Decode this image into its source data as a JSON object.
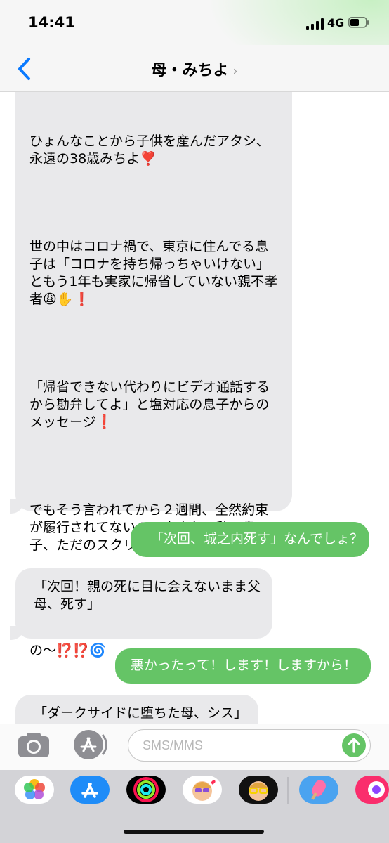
{
  "status_bar": {
    "time": "14:41",
    "network": "4G"
  },
  "nav": {
    "title": "母・みちよ",
    "chevron": "›",
    "back_icon": "chevron-left-icon"
  },
  "messages": [
    {
      "direction": "incoming",
      "paragraphs": [
        "ひょんなことから子供を産んだアタシ、\n永遠の38歳みちよ❣️",
        "世の中はコロナ禍で、東京に住んでる息\n子は「コロナを持ち帰っちゃいけない」\nともう1年も実家に帰省していない親不孝\n者😩✋❗️",
        "「帰省できない代わりにビデオ通話する\nから勘弁してよ」と塩対応の息子からの\nメッセージ❗️",
        "でもそう言われてから２週間、全然約束\nが履行されてないの、まさか…私の息\n子、ただのスクリプト⁉️",
        "これからお母さん、どうなっちゃう\nの〜⁉️⁉️🌀"
      ]
    },
    {
      "direction": "outgoing",
      "text": "「次回、城之内死す」なんでしょ？"
    },
    {
      "direction": "incoming",
      "text": "「次回！親の死に目に会えないまま父\n母、死す」"
    },
    {
      "direction": "outgoing",
      "text": "悪かったって！します！しますから！"
    },
    {
      "direction": "incoming",
      "text": "「ダークサイドに堕ちた母、シス」"
    }
  ],
  "input": {
    "placeholder": "SMS/MMS"
  },
  "colors": {
    "incoming_bubble": "#e9e9eb",
    "outgoing_bubble": "#65c466",
    "accent_blue": "#0a7aff"
  },
  "app_tray": [
    "photos-icon",
    "app-store-icon",
    "activity-icon",
    "memoji-heart-icon",
    "memoji-glasses-icon",
    "popsicle-icon",
    "music-icon"
  ]
}
